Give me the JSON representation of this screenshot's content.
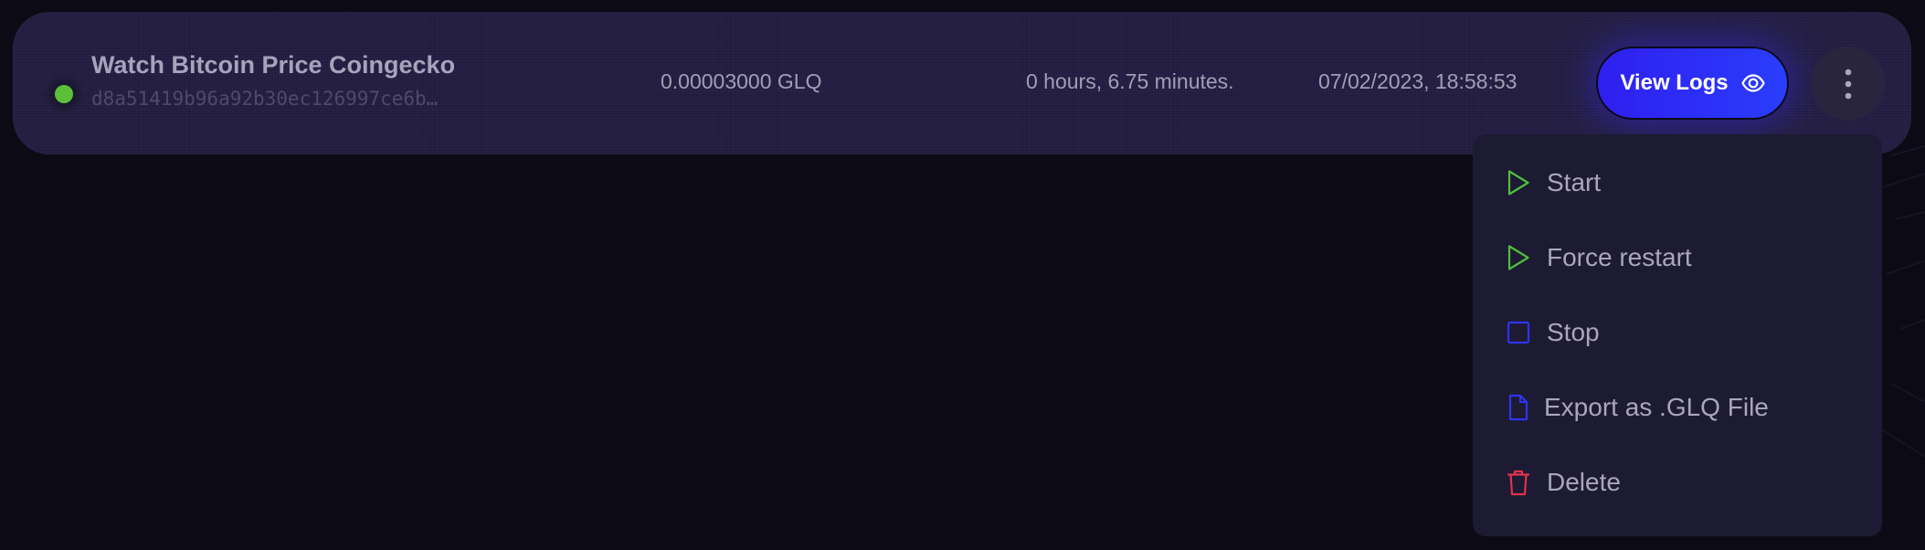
{
  "job": {
    "name": "Watch Bitcoin Price Coingecko",
    "id": "d8a51419b96a92b30ec126997ce6b…",
    "cost": "0.00003000 GLQ",
    "duration": "0 hours, 6.75 minutes.",
    "timestamp": "07/02/2023, 18:58:53",
    "status_icon": "online-dot",
    "status_color": "#5bbf3a"
  },
  "actions": {
    "view_logs_label": "View Logs",
    "view_logs_icon": "eye-icon",
    "more_icon": "vertical-ellipsis-icon"
  },
  "menu": {
    "items": [
      {
        "label": "Start",
        "icon": "play-icon",
        "color": "#4fbf3a"
      },
      {
        "label": "Force restart",
        "icon": "play-icon",
        "color": "#4fbf3a"
      },
      {
        "label": "Stop",
        "icon": "stop-icon",
        "color": "#2d35e8"
      },
      {
        "label": "Export as .GLQ File",
        "icon": "file-icon",
        "color": "#2d35e8"
      },
      {
        "label": "Delete",
        "icon": "trash-icon",
        "color": "#e2334b"
      }
    ]
  },
  "colors": {
    "background": "#0c0b15",
    "card": "#221d40",
    "accent": "#2f1ff0",
    "menu": "#1d1a33"
  }
}
